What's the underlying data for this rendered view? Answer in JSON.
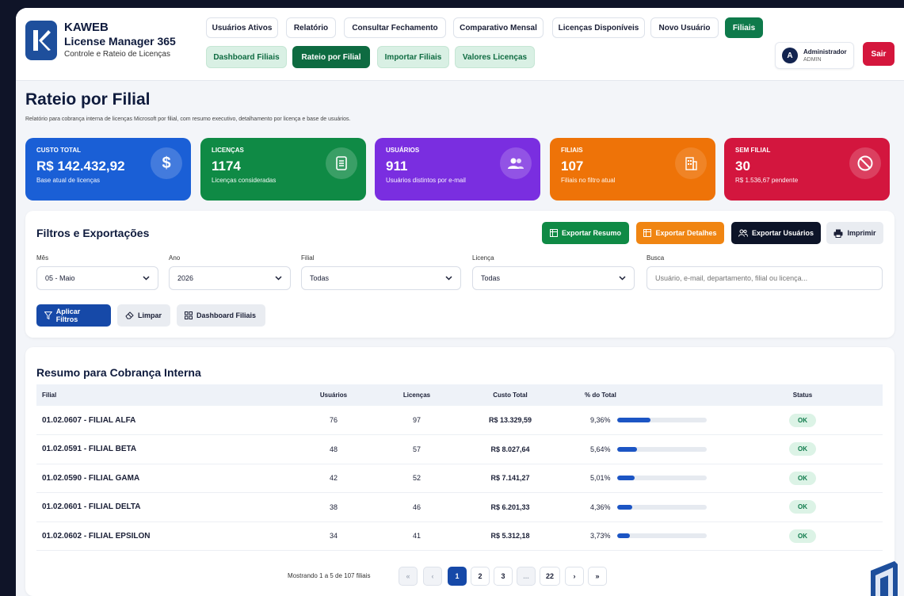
{
  "brand": {
    "name": "KAWEB",
    "product": "License Manager 365",
    "tagline": "Controle e Rateio de Licenças"
  },
  "nav": {
    "row1": [
      "Usuários Ativos",
      "Relatório",
      "Consultar Fechamento",
      "Comparativo Mensal",
      "Licenças Disponíveis",
      "Novo Usuário",
      "Filiais"
    ],
    "row2": [
      "Dashboard Filiais",
      "Rateio por Filial",
      "Importar Filiais",
      "Valores Licenças"
    ],
    "active_row1": "Filiais",
    "active_row2": "Rateio por Filial"
  },
  "user": {
    "initial": "A",
    "name": "Administrador",
    "role": "ADMIN",
    "logout": "Sair"
  },
  "page": {
    "title": "Rateio por Filial",
    "subtitle": "Relatório para cobrança interna de licenças Microsoft por filial, com resumo executivo, detalhamento por licença e base de usuários."
  },
  "cards": [
    {
      "label": "CUSTO TOTAL",
      "value": "R$ 142.432,92",
      "sub": "Base atual de licenças",
      "color": "#1a5fd6",
      "icon": "dollar-icon"
    },
    {
      "label": "LICENÇAS",
      "value": "1174",
      "sub": "Licenças consideradas",
      "color": "#0f8a45",
      "icon": "document-icon"
    },
    {
      "label": "USUÁRIOS",
      "value": "911",
      "sub": "Usuários distintos por e-mail",
      "color": "#7a2ee0",
      "icon": "users-icon"
    },
    {
      "label": "FILIAIS",
      "value": "107",
      "sub": "Filiais no filtro atual",
      "color": "#ee7308",
      "icon": "building-icon"
    },
    {
      "label": "SEM FILIAL",
      "value": "30",
      "sub": "R$ 1.536,67 pendente",
      "color": "#d3163e",
      "icon": "ban-icon"
    }
  ],
  "filters": {
    "title": "Filtros e Exportações",
    "export_summary": "Exportar Resumo",
    "export_details": "Exportar Detalhes",
    "export_users": "Exportar Usuários",
    "print": "Imprimir",
    "month_label": "Mês",
    "month_value": "05 - Maio",
    "year_label": "Ano",
    "year_value": "2026",
    "branch_label": "Filial",
    "branch_value": "Todas",
    "license_label": "Licença",
    "license_value": "Todas",
    "search_label": "Busca",
    "search_placeholder": "Usuário, e-mail, departamento, filial ou licença...",
    "apply": "Aplicar Filtros",
    "clear": "Limpar",
    "dashboard": "Dashboard Filiais"
  },
  "summary": {
    "title": "Resumo para Cobrança Interna",
    "columns": [
      "Filial",
      "Usuários",
      "Licenças",
      "Custo Total",
      "% do Total",
      "Status"
    ],
    "rows": [
      {
        "filial": "01.02.0607 - FILIAL ALFA",
        "usuarios": "76",
        "licencas": "97",
        "custo": "R$ 13.329,59",
        "pct": "9,36%",
        "pct_value": 9.36,
        "status": "OK"
      },
      {
        "filial": "01.02.0591 - FILIAL BETA",
        "usuarios": "48",
        "licencas": "57",
        "custo": "R$ 8.027,64",
        "pct": "5,64%",
        "pct_value": 5.64,
        "status": "OK"
      },
      {
        "filial": "01.02.0590 - FILIAL GAMA",
        "usuarios": "42",
        "licencas": "52",
        "custo": "R$ 7.141,27",
        "pct": "5,01%",
        "pct_value": 5.01,
        "status": "OK"
      },
      {
        "filial": "01.02.0601 - FILIAL DELTA",
        "usuarios": "38",
        "licencas": "46",
        "custo": "R$ 6.201,33",
        "pct": "4,36%",
        "pct_value": 4.36,
        "status": "OK"
      },
      {
        "filial": "01.02.0602 - FILIAL EPSILON",
        "usuarios": "34",
        "licencas": "41",
        "custo": "R$ 5.312,18",
        "pct": "3,73%",
        "pct_value": 3.73,
        "status": "OK"
      }
    ],
    "bar_max_pct": 25,
    "pagination": {
      "info": "Mostrando 1 a 5 de 107 filiais",
      "first": "«",
      "prev": "‹",
      "pages": [
        "1",
        "2",
        "3",
        "...",
        "22"
      ],
      "next": "›",
      "last": "»",
      "current": "1"
    }
  },
  "colors": {
    "accent_green": "#0e7a4b",
    "accent_blue": "#1649a8",
    "danger": "#d4163c",
    "orange": "#ee7308",
    "dark": "#0f1428"
  }
}
